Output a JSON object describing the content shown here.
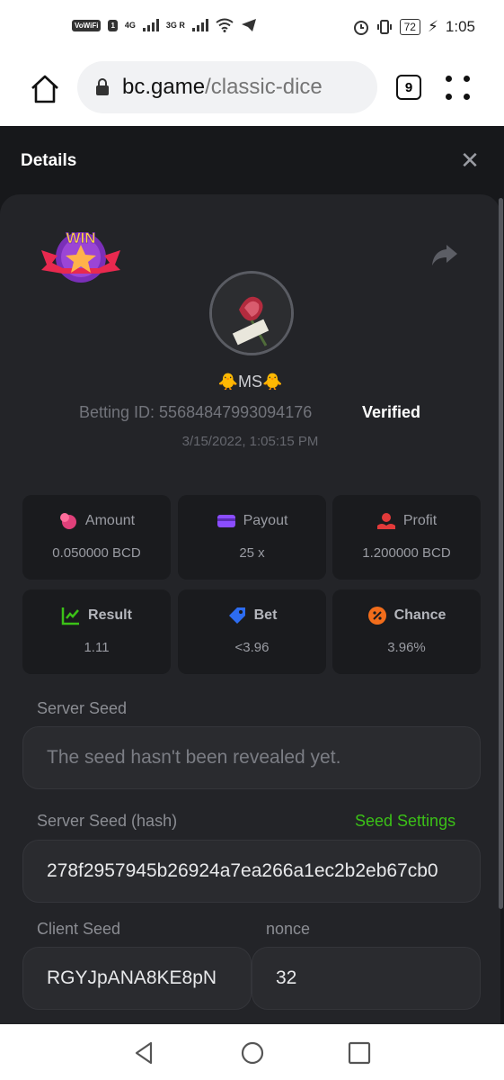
{
  "status_bar": {
    "carrier_badge": "VoWiFi",
    "sim_badge": "1",
    "net1": "4G",
    "net2": "3G R",
    "battery": "72",
    "time": "1:05"
  },
  "browser": {
    "url_host": "bc.game",
    "url_path": "/classic-dice",
    "tab_count": "9"
  },
  "modal": {
    "title": "Details",
    "close_label": "✕",
    "win_label": "WIN",
    "username": "🐥MS🐥",
    "betting_id": "Betting ID: 55684847993094176",
    "verified": "Verified",
    "timestamp": "3/15/2022, 1:05:15 PM",
    "stats": [
      {
        "label": "Amount",
        "value": "0.050000 BCD",
        "icon": "coins-icon",
        "color": "#e0407a"
      },
      {
        "label": "Payout",
        "value": "25 x",
        "icon": "card-icon",
        "color": "#8b4dff"
      },
      {
        "label": "Profit",
        "value": "1.200000 BCD",
        "icon": "hand-coin-icon",
        "color": "#e23a3a"
      },
      {
        "label": "Result",
        "value": "1.11",
        "icon": "chart-check-icon",
        "color": "#3bc117"
      },
      {
        "label": "Bet",
        "value": "<3.96",
        "icon": "tag-icon",
        "color": "#2d6cf0"
      },
      {
        "label": "Chance",
        "value": "3.96%",
        "icon": "percent-icon",
        "color": "#f26d1b"
      }
    ],
    "server_seed_label": "Server Seed",
    "server_seed_value": "The seed hasn't been revealed yet.",
    "server_seed_hash_label": "Server Seed (hash)",
    "seed_settings_label": "Seed Settings",
    "server_seed_hash_value": "278f2957945b26924a7ea266a1ec2b2eb67cb0",
    "client_seed_label": "Client Seed",
    "client_seed_value": "RGYJpANA8KE8pN",
    "nonce_label": "nonce",
    "nonce_value": "32"
  },
  "colors": {
    "accent_green": "#3bc117",
    "panel_bg": "#232428",
    "page_bg": "#17181b"
  }
}
